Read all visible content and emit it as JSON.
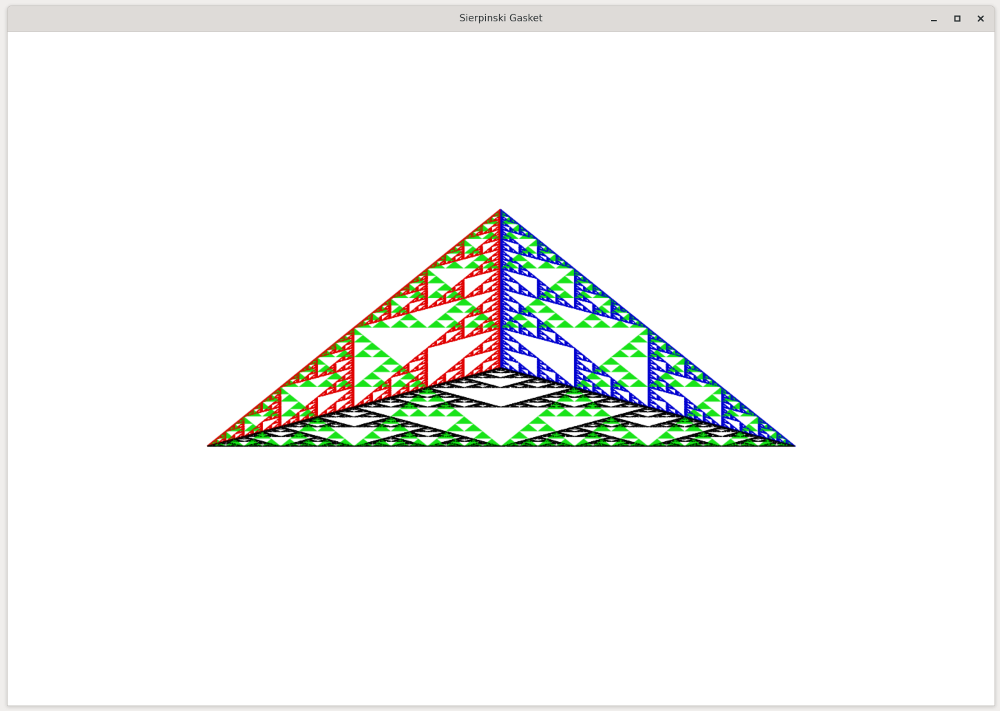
{
  "window": {
    "title": "Sierpinski Gasket",
    "controls": {
      "minimize_icon": "minimize-icon",
      "maximize_icon": "maximize-icon",
      "close_icon": "close-icon"
    }
  },
  "canvas": {
    "background": "#ffffff",
    "colors": {
      "left_face": "#e00000",
      "right_face": "#0000d0",
      "front_face": "#000000",
      "filled_triangles": "#00e000"
    }
  }
}
